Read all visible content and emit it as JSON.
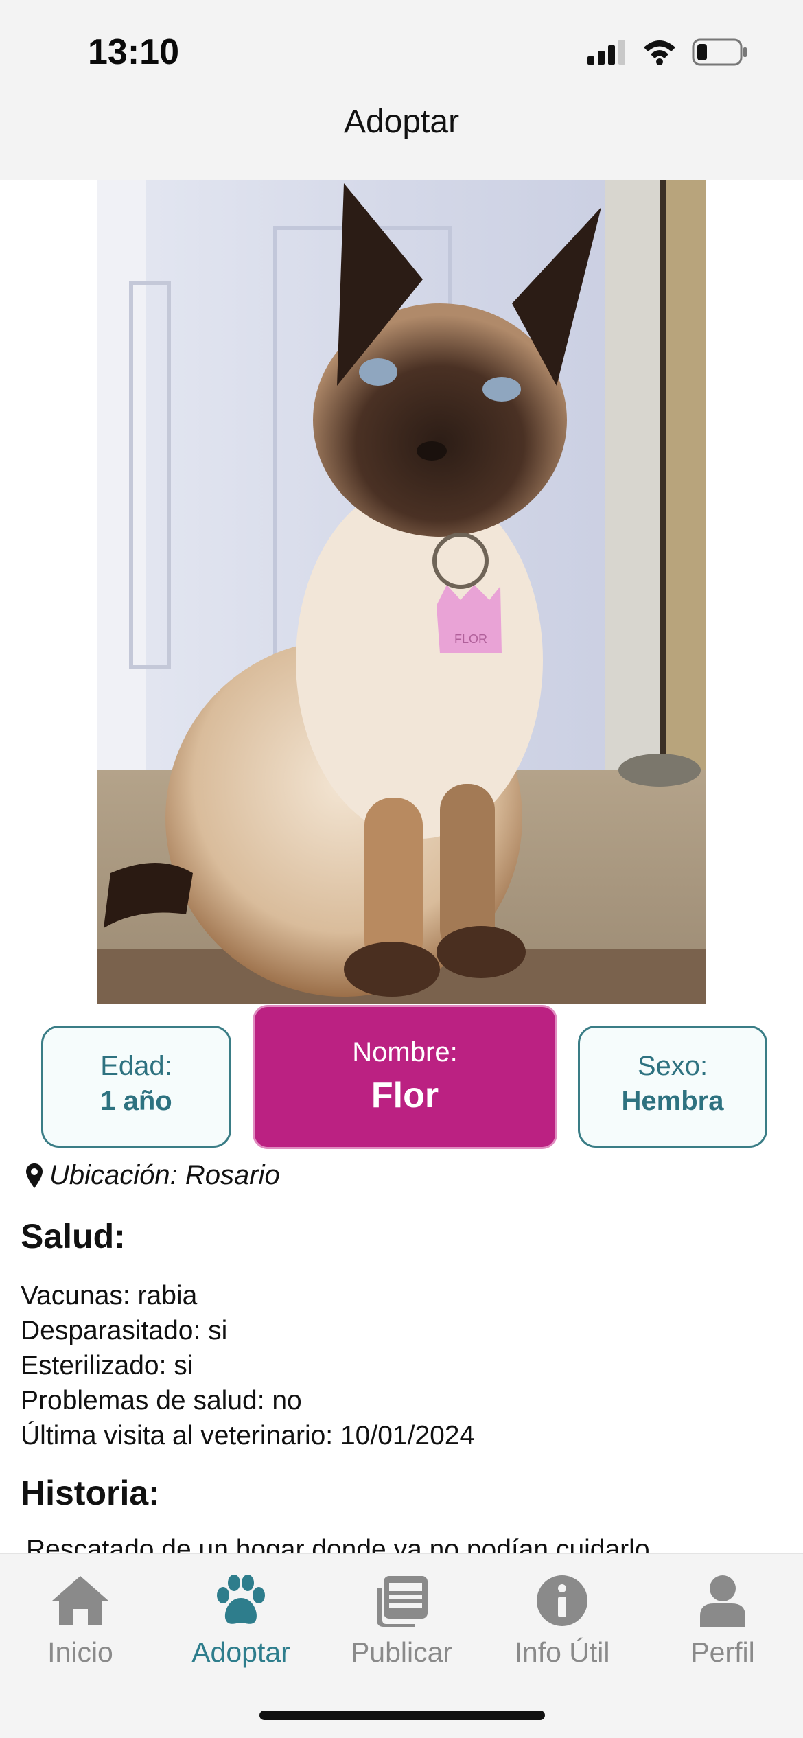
{
  "status_bar": {
    "time": "13:10"
  },
  "header": {
    "title": "Adoptar"
  },
  "pet": {
    "photo_label": "FLOR",
    "edad_label": "Edad:",
    "edad_value": "1 año",
    "nombre_label": "Nombre:",
    "nombre_value": "Flor",
    "sexo_label": "Sexo:",
    "sexo_value": "Hembra",
    "location": "Ubicación: Rosario"
  },
  "salud": {
    "heading": "Salud:",
    "lines": [
      "Vacunas: rabia",
      "Desparasitado: si",
      "Esterilizado: si",
      "Problemas de salud: no",
      "Última visita al veterinario: 10/01/2024"
    ]
  },
  "historia": {
    "heading": "Historia:",
    "text": "Rescatado de un hogar donde ya no podían cuidarlo"
  },
  "tabbar": {
    "active": "Adoptar",
    "accent": "#2e7d8c",
    "items": [
      {
        "label": "Inicio",
        "icon": "home-icon"
      },
      {
        "label": "Adoptar",
        "icon": "paw-icon"
      },
      {
        "label": "Publicar",
        "icon": "newspaper-icon"
      },
      {
        "label": "Info Útil",
        "icon": "info-icon"
      },
      {
        "label": "Perfil",
        "icon": "user-icon"
      }
    ]
  },
  "colors": {
    "name_card": "#bb2182",
    "card_border": "#3a7d86"
  }
}
